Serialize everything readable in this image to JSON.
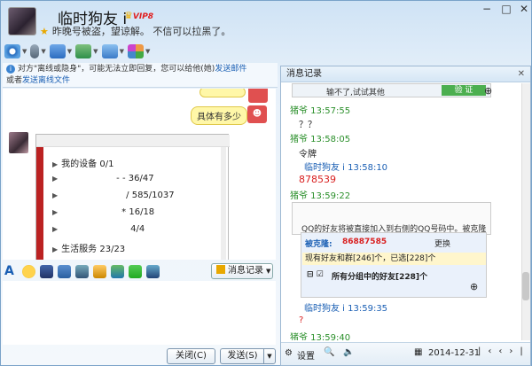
{
  "header": {
    "title": "临时狗友 i",
    "vip": "VIP8",
    "signature": "昨晚号被盗，望谅解。 不信可以拉黑了。"
  },
  "window_controls": [
    "−",
    "□",
    "✕"
  ],
  "toolbar": [
    "video",
    "voice",
    "transfer-file",
    "remote-desktop",
    "screen-share",
    "apps"
  ],
  "notice": {
    "text": "对方\"离线或隐身\"，可能无法立即回复，您可以给他(她)",
    "link1": "发送邮件",
    "text2": "或者",
    "link2": "发送离线文件"
  },
  "chat": {
    "bubble": "具体有多少"
  },
  "screenshot_list": {
    "rows": [
      {
        "label": "我的设备",
        "count": "0/1"
      },
      {
        "label": "- -",
        "count": "36/47"
      },
      {
        "label": "/",
        "count": "585/1037"
      },
      {
        "label": "*",
        "count": "16/18"
      },
      {
        "label": "",
        "count": "4/4"
      },
      {
        "label": "生活服务",
        "count": "23/23"
      }
    ]
  },
  "input_toolbar": {
    "history_label": "消息记录"
  },
  "buttons": {
    "close": "关闭(C)",
    "send": "发送(S)"
  },
  "history": {
    "title": "消息记录",
    "img1": {
      "text": "输不了,试试其他",
      "btn": "验 证"
    },
    "messages": [
      {
        "sender": "猪爷 13:57:55",
        "text": "？？",
        "sender_color": "green"
      },
      {
        "sender": "猪爷 13:58:05",
        "text": "令牌",
        "sender_color": "green"
      },
      {
        "sender": "临时狗友 i 13:58:10",
        "text": "878539",
        "sender_color": "blue",
        "red": true
      },
      {
        "sender": "猪爷 13:59:22",
        "text": "",
        "sender_color": "green"
      },
      {
        "sender": "临时狗友 i 13:59:35",
        "text": "?",
        "sender_color": "blue",
        "red": true
      },
      {
        "sender": "猪爷 13:59:40",
        "text": "",
        "sender_color": "green"
      }
    ],
    "img2": {
      "line1": "QQ的好友将被直接加入到右侧的QQ号码中。被克隆",
      "clone_label": "被克隆:",
      "clone_num": "86887585",
      "change": "更换",
      "existing": "现有好友和群[246]个，已选[228]个",
      "group": "所有分组中的好友[228]个"
    },
    "footer": {
      "settings": "设置",
      "date": "2014-12-31"
    }
  }
}
